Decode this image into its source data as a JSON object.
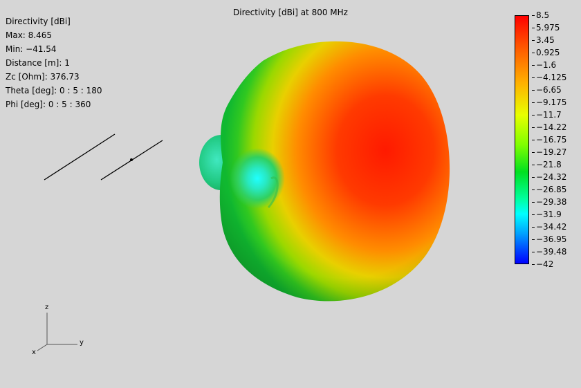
{
  "window": {
    "title": "Directivity [dBi] at 800 MHz"
  },
  "info": {
    "lines": [
      "Directivity [dBi]",
      "Max: 8.465",
      "Min: −41.54",
      "Distance [m]: 1",
      "Zc [Ohm]: 376.73",
      "Theta [deg]: 0 : 5 : 180",
      "Phi [deg]: 0 : 5 : 360"
    ]
  },
  "colorbar": {
    "ticks": [
      "8.5",
      "5.975",
      "3.45",
      "0.925",
      "−1.6",
      "−4.125",
      "−6.65",
      "−9.175",
      "−11.7",
      "−14.22",
      "−16.75",
      "−19.27",
      "−21.8",
      "−24.32",
      "−26.85",
      "−29.38",
      "−31.9",
      "−34.42",
      "−36.95",
      "−39.48",
      "−42"
    ],
    "max_color": "#ff0000",
    "min_color": "#0000ff"
  },
  "axes": {
    "x_label": "x",
    "y_label": "y",
    "z_label": "z"
  }
}
